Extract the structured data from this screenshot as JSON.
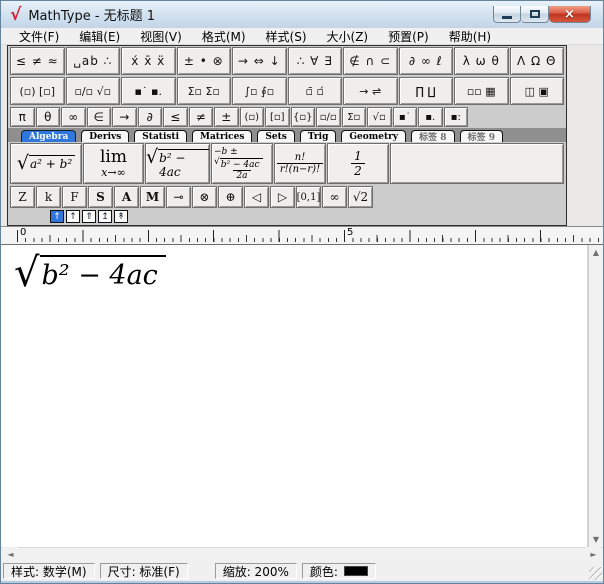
{
  "window": {
    "title": "MathType - 无标题 1",
    "logo_glyph": "√",
    "close_glyph": "×"
  },
  "menu": {
    "items": [
      "文件(F)",
      "编辑(E)",
      "视图(V)",
      "格式(M)",
      "样式(S)",
      "大小(Z)",
      "预置(P)",
      "帮助(H)"
    ]
  },
  "toolbar": {
    "row1": [
      "≤ ≠ ≈",
      "␣ab ∴",
      "x́ x̄ ẍ",
      "± • ⊗",
      "→ ⇔ ↓",
      "∴ ∀ ∃",
      "∉ ∩ ⊂",
      "∂ ∞ ℓ",
      "λ ω θ",
      "Λ Ω Θ"
    ],
    "row2": [
      "(▫) [▫]",
      "▫∕▫ √▫",
      "▪˙ ▪.",
      "Σ▫ Σ▫",
      "∫▫ ∮▫",
      "▫̄ ▫́",
      "→ ⇌",
      "∏ ∐",
      "▫▫ ▦",
      "◫ ▣"
    ],
    "smallbar": [
      "π",
      "θ",
      "∞",
      "∈",
      "→",
      "∂",
      "≤",
      "≠",
      "±",
      "(▫)",
      "[▫]",
      "{▫}",
      "▫∕▫",
      "Σ▫",
      "√▫",
      "▪˙",
      "▪.",
      "▪:"
    ],
    "tabs": [
      {
        "label": "Algebra",
        "active": true
      },
      {
        "label": "Derivs",
        "active": false
      },
      {
        "label": "Statisti",
        "active": false
      },
      {
        "label": "Matrices",
        "active": false
      },
      {
        "label": "Sets",
        "active": false
      },
      {
        "label": "Trig",
        "active": false
      },
      {
        "label": "Geometry",
        "active": false
      },
      {
        "label": "标签 8",
        "active": false
      },
      {
        "label": "标签 9",
        "active": false
      }
    ],
    "templates": {
      "sqrt_a2b2": {
        "sign": "√",
        "radicand": "a² + b²"
      },
      "limit": {
        "top": "lim",
        "bottom": "x→∞"
      },
      "sqrt_b24ac": {
        "sign": "√",
        "radicand": "b² − 4ac"
      },
      "quadratic": {
        "num_pre": "−b ±",
        "sign": "√",
        "radicand": "b² − 4ac",
        "den": "2a"
      },
      "binomial": {
        "num": "n!",
        "den": "r!(n−r)!"
      },
      "half": {
        "num": "1",
        "den": "2"
      }
    },
    "letters": [
      "Z",
      "k",
      "F",
      "S",
      "A",
      "M",
      "⊸",
      "⊗",
      "⊕",
      "◁",
      "▷",
      "[0,1]",
      "∞",
      "√2"
    ],
    "tiny_buttons": [
      "↑",
      "↑",
      "⇑",
      "↥",
      "↟"
    ]
  },
  "ruler": {
    "labels": [
      "0",
      "5"
    ]
  },
  "editor": {
    "equation": {
      "sign": "√",
      "radicand": "b² − 4ac"
    }
  },
  "statusbar": {
    "style": "样式: 数学(M)",
    "size": "尺寸: 标准(F)",
    "zoom": "缩放: 200%",
    "color_label": "颜色:",
    "color_value": "#000000"
  }
}
